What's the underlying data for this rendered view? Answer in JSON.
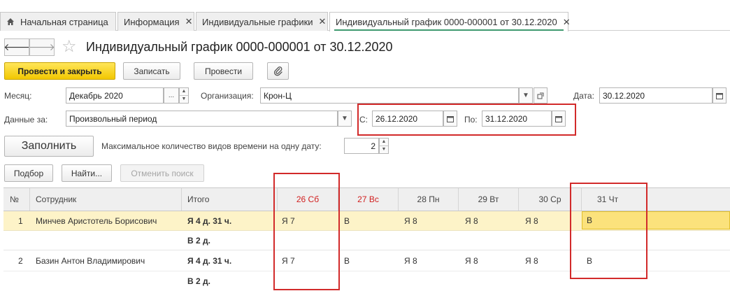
{
  "tabs": [
    {
      "label": "Начальная страница",
      "closable": false
    },
    {
      "label": "Информация",
      "closable": true
    },
    {
      "label": "Индивидуальные графики",
      "closable": true
    },
    {
      "label": "Индивидуальный график 0000-000001 от 30.12.2020",
      "closable": true,
      "active": true
    }
  ],
  "tab_close_glyph": "✕",
  "nav": {
    "back": "🡐",
    "forward": "🡒"
  },
  "title": "Индивидуальный график 0000-000001 от 30.12.2020",
  "toolbar": {
    "post_close": "Провести и закрыть",
    "save": "Записать",
    "post": "Провести"
  },
  "form": {
    "month_label": "Месяц:",
    "month_value": "Декабрь 2020",
    "org_label": "Организация:",
    "org_value": "Крон-Ц",
    "date_label": "Дата:",
    "date_value": "30.12.2020",
    "data_for_label": "Данные за:",
    "data_for_value": "Произвольный период",
    "from_label": "С:",
    "from_value": "26.12.2020",
    "to_label": "По:",
    "to_value": "31.12.2020",
    "fill_button": "Заполнить",
    "max_types_label": "Максимальное количество видов времени на одну дату:",
    "max_types_value": "2"
  },
  "list_toolbar": {
    "select": "Подбор",
    "find": "Найти...",
    "cancel_search": "Отменить поиск"
  },
  "table": {
    "headers": [
      "№",
      "Сотрудник",
      "Итого",
      "26 Сб",
      "27 Вс",
      "28 Пн",
      "29 Вт",
      "30 Ср",
      "31 Чт"
    ],
    "weekend_color": "#d11f1f",
    "rows": [
      {
        "num": "1",
        "employee": "Минчев Аристотель Борисович",
        "total1": "Я 4 д. 31 ч.",
        "total2": "В 2 д.",
        "days": [
          "Я 7",
          "В",
          "Я 8",
          "Я 8",
          "Я 8",
          "В"
        ],
        "selected": true
      },
      {
        "num": "2",
        "employee": "Базин Антон Владимирович",
        "total1": "Я 4 д. 31 ч.",
        "total2": "В 2 д.",
        "days": [
          "Я 7",
          "В",
          "Я 8",
          "Я 8",
          "Я 8",
          "В"
        ],
        "selected": false
      }
    ]
  },
  "colors": {
    "accent_yellow": "#f2c700",
    "selected_row": "#fdf3c8",
    "active_cell": "#fbe27c",
    "highlight_red": "#d22a2a",
    "active_tab_underline": "#3f9a6f"
  }
}
